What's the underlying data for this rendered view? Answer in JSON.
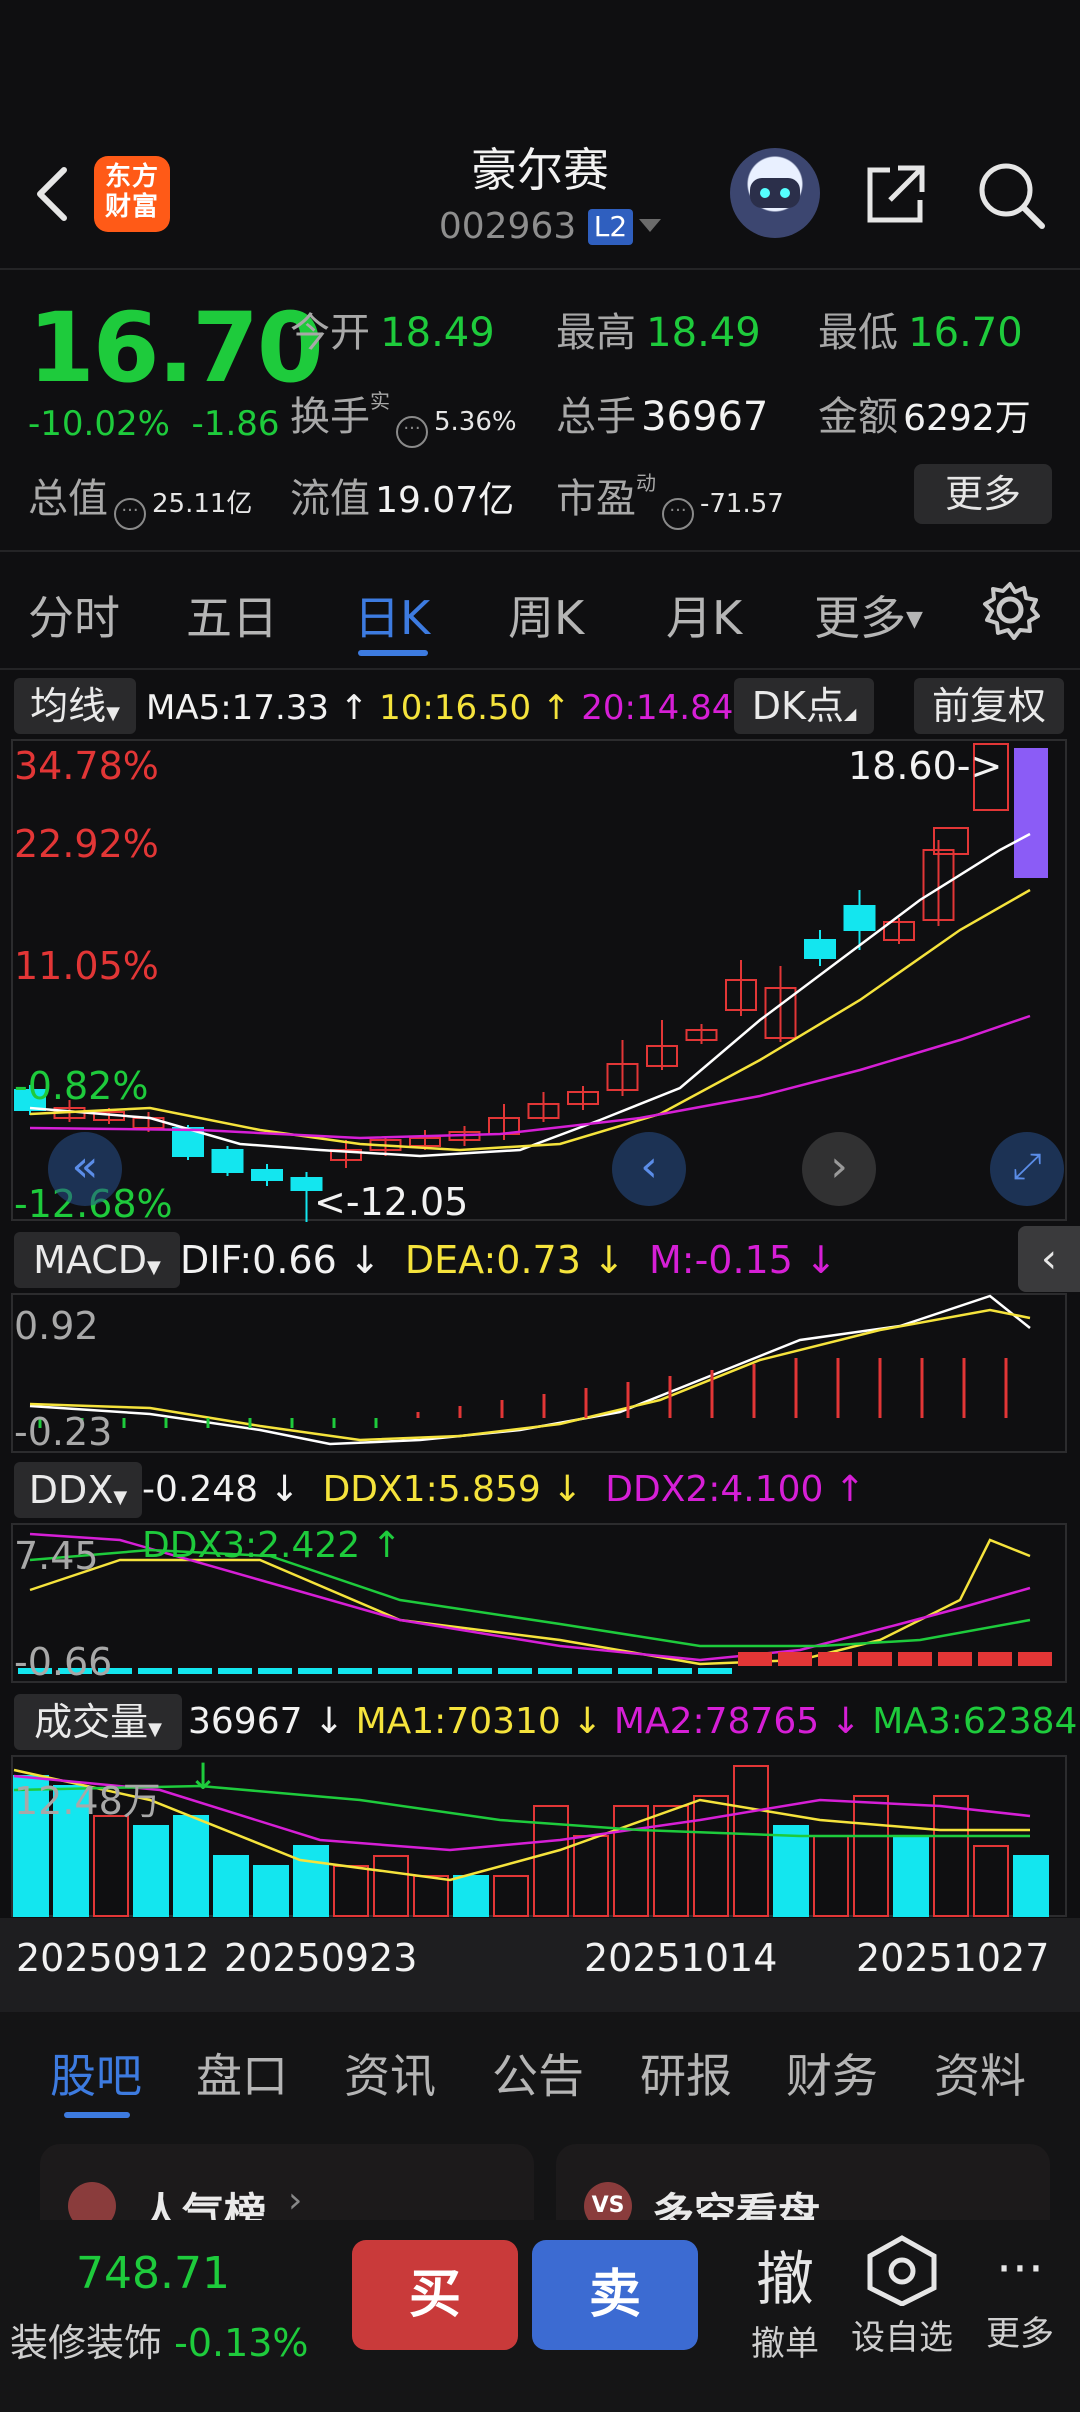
{
  "header": {
    "logo_text": "东方财富",
    "stock_name": "豪尔赛",
    "stock_code": "002963",
    "level_badge": "L2"
  },
  "quote": {
    "price": "16.70",
    "change_pct": "-10.02%",
    "change_amt": "-1.86",
    "open_label": "今开",
    "open_value": "18.49",
    "high_label": "最高",
    "high_value": "18.49",
    "low_label": "最低",
    "low_value": "16.70",
    "turnover_label": "换手",
    "turnover_sup": "实",
    "turnover_value": "5.36%",
    "volume_label": "总手",
    "volume_value": "36967",
    "amount_label": "金额",
    "amount_value": "6292万",
    "mktcap_label": "总值",
    "mktcap_value": "25.11亿",
    "float_label": "流值",
    "float_value": "19.07亿",
    "pe_label": "市盈",
    "pe_sup": "动",
    "pe_value": "-71.57",
    "more_label": "更多"
  },
  "period_tabs": [
    "分时",
    "五日",
    "日K",
    "周K",
    "月K",
    "更多"
  ],
  "active_period": "日K",
  "chart_toolbar": {
    "ma_dropdown": "均线",
    "ma5": "MA5:17.33 ↑",
    "ma10": "10:16.50 ↑",
    "ma20": "20:14.84 ↑",
    "dk_button": "DK点",
    "adjust_button": "前复权"
  },
  "kline": {
    "y_labels": [
      "34.78%",
      "22.92%",
      "11.05%",
      "-0.82%",
      "-12.68%"
    ],
    "max_annotation": "18.60->",
    "min_annotation": "<-12.05"
  },
  "macd": {
    "name": "MACD",
    "dif": "DIF:0.66 ↓",
    "dea": "DEA:0.73 ↓",
    "m": "M:-0.15 ↓",
    "y_top": "0.92",
    "y_bottom": "-0.23"
  },
  "ddx": {
    "name": "DDX",
    "ddx": "-0.248 ↓",
    "ddx1": "DDX1:5.859 ↓",
    "ddx2": "DDX2:4.100 ↑",
    "ddx3": "DDX3:2.422 ↑",
    "y_top": "7.45",
    "y_bottom": "-0.66"
  },
  "volume": {
    "name": "成交量",
    "vol": "36967 ↓",
    "ma1": "MA1:70310 ↓",
    "ma2": "MA2:78765 ↓",
    "ma3": "MA3:62384 ↓",
    "y_top": "12.48万"
  },
  "x_dates": [
    "20250912",
    "20250923",
    "20251014",
    "20251027"
  ],
  "bottom_tabs": [
    "股吧",
    "盘口",
    "资讯",
    "公告",
    "研报",
    "财务",
    "资料"
  ],
  "active_bottom_tab": "股吧",
  "cards": [
    {
      "icon": "人气",
      "label": "人气榜"
    },
    {
      "icon": "VS",
      "label": "多空看盘"
    }
  ],
  "index": {
    "value": "748.71",
    "name": "装修装饰",
    "change": "-0.13%"
  },
  "actions": {
    "buy": "买",
    "sell": "卖",
    "cancel_big": "撤",
    "cancel": "撤单",
    "watch": "设自选",
    "more": "更多"
  },
  "colors": {
    "up": "#e23636",
    "down": "#1ecb3c",
    "accent": "#3d7be0",
    "ma5": "#ffffff",
    "ma10": "#f5e33c",
    "ma20": "#d61fd6",
    "cyan": "#13e6ef"
  }
}
